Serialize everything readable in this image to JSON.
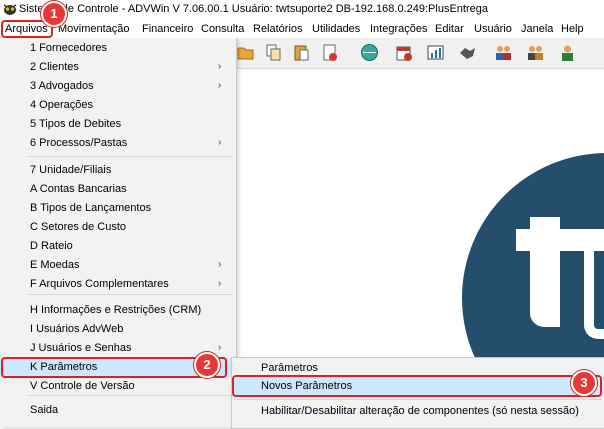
{
  "window": {
    "title": "Sistema de Controle - ADVWin  V 7.06.00.1  Usuário: twtsuporte2  DB-192.168.0.249:PlusEntrega"
  },
  "menubar": [
    "Arquivos",
    "Movimentação",
    "Financeiro",
    "Consulta",
    "Relatórios",
    "Utilidades",
    "Integrações",
    "Editar",
    "Usuário",
    "Janela",
    "Help"
  ],
  "toolbar_icons": [
    "folder-icon",
    "copy-icon",
    "paste-icon",
    "document-icon",
    "globe-icon",
    "calendar-icon",
    "calculator-icon",
    "chart-icon",
    "handshake-icon",
    "users-icon",
    "users-group-icon",
    "user-icon"
  ],
  "arquivos_menu": {
    "items": [
      {
        "label": "1 Fornecedores",
        "submenu": false
      },
      {
        "label": "2 Clientes",
        "submenu": true
      },
      {
        "label": "3 Advogados",
        "submenu": true
      },
      {
        "label": "4 Operações",
        "submenu": false
      },
      {
        "label": "5 Tipos de Debites",
        "submenu": false
      },
      {
        "label": "6 Processos/Pastas",
        "submenu": true
      },
      {
        "label": "7 Unidade/Filiais",
        "submenu": false
      },
      {
        "label": "A Contas Bancarias",
        "submenu": false
      },
      {
        "label": "B Tipos de Lançamentos",
        "submenu": false
      },
      {
        "label": "C Setores de Custo",
        "submenu": false
      },
      {
        "label": "D Rateio",
        "submenu": false
      },
      {
        "label": "E Moedas",
        "submenu": true
      },
      {
        "label": "F Arquivos Complementares",
        "submenu": true
      },
      {
        "label": "H Informações e Restrições (CRM)",
        "submenu": false
      },
      {
        "label": "I Usuários AdvWeb",
        "submenu": false
      },
      {
        "label": "J Usuários e Senhas",
        "submenu": true
      },
      {
        "label": "K Parâmetros",
        "submenu": true
      },
      {
        "label": "V Controle de Versão",
        "submenu": false
      },
      {
        "label": "Saida",
        "submenu": false
      }
    ],
    "arrow": "›"
  },
  "parametros_submenu": {
    "items": [
      {
        "label": "Parâmetros"
      },
      {
        "label": "Novos Parâmetros"
      },
      {
        "label": "Habilitar/Desabilitar alteração de componentes (só nesta sessão)"
      }
    ]
  },
  "annotations": {
    "badge1": "1",
    "badge2": "2",
    "badge3": "3"
  },
  "colors": {
    "highlight": "#cce8ff",
    "annotation": "#e02020",
    "logo": "#244e6c"
  }
}
